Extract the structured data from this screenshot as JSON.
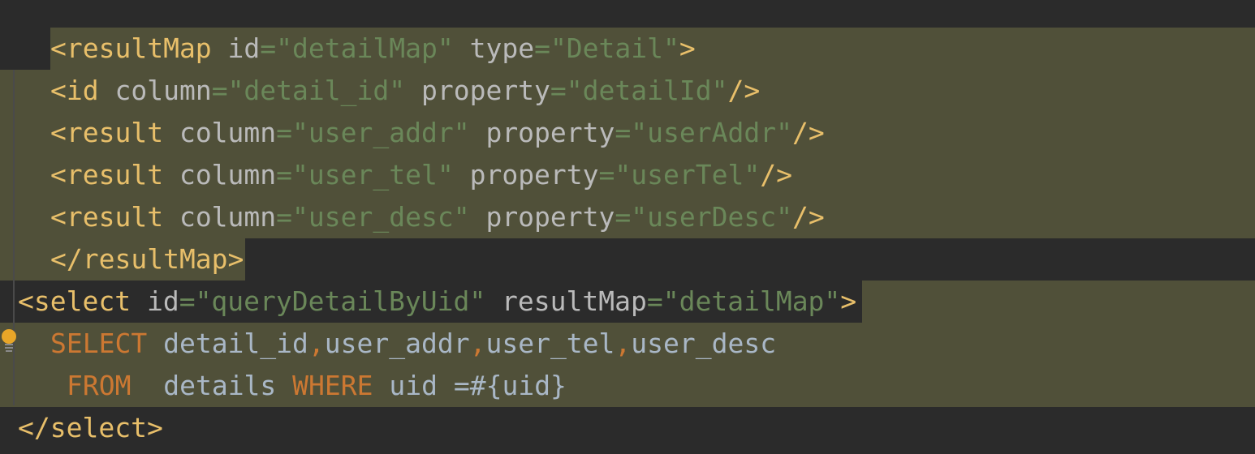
{
  "editor": {
    "language": "xml",
    "colors": {
      "background": "#2b2b2b",
      "selection": "#505039",
      "tag": "#e8bf6a",
      "attribute": "#bababa",
      "string": "#6a8759",
      "keyword": "#cc7832",
      "text": "#a9b7c6"
    },
    "lines": [
      {
        "tag_open": "<resultMap",
        "attr1": " id",
        "eq1": "=",
        "val1": "\"detailMap\"",
        "attr2": " type",
        "eq2": "=",
        "val2": "\"Detail\"",
        "tag_close": ">"
      },
      {
        "tag_open": "<id",
        "attr1": " column",
        "eq1": "=",
        "val1": "\"detail_id\"",
        "attr2": " property",
        "eq2": "=",
        "val2": "\"detailId\"",
        "tag_close": "/>"
      },
      {
        "tag_open": "<result",
        "attr1": " column",
        "eq1": "=",
        "val1": "\"user_addr\"",
        "attr2": " property",
        "eq2": "=",
        "val2": "\"userAddr\"",
        "tag_close": "/>"
      },
      {
        "tag_open": "<result",
        "attr1": " column",
        "eq1": "=",
        "val1": "\"user_tel\"",
        "attr2": " property",
        "eq2": "=",
        "val2": "\"userTel\"",
        "tag_close": "/>"
      },
      {
        "tag_open": "<result",
        "attr1": " column",
        "eq1": "=",
        "val1": "\"user_desc\"",
        "attr2": " property",
        "eq2": "=",
        "val2": "\"userDesc\"",
        "tag_close": "/>"
      },
      {
        "tag_full": "</resultMap>"
      },
      {
        "tag_open": "<select",
        "attr1": " id",
        "eq1": "=",
        "val1": "\"queryDetailByUid\"",
        "attr2": " resultMap",
        "eq2": "=",
        "val2": "\"detailMap\"",
        "tag_close": ">"
      },
      {
        "kw": "SELECT",
        "c1": " detail_id",
        "comma1": ",",
        "c2": "user_addr",
        "comma2": ",",
        "c3": "user_tel",
        "comma3": ",",
        "c4": "user_desc"
      },
      {
        "kw1": "FROM",
        "t1": "  details ",
        "kw2": "WHERE",
        "t2": " uid =#{uid}"
      },
      {
        "tag_full": "</select>"
      }
    ],
    "bulb_icon": "lightbulb-icon"
  }
}
